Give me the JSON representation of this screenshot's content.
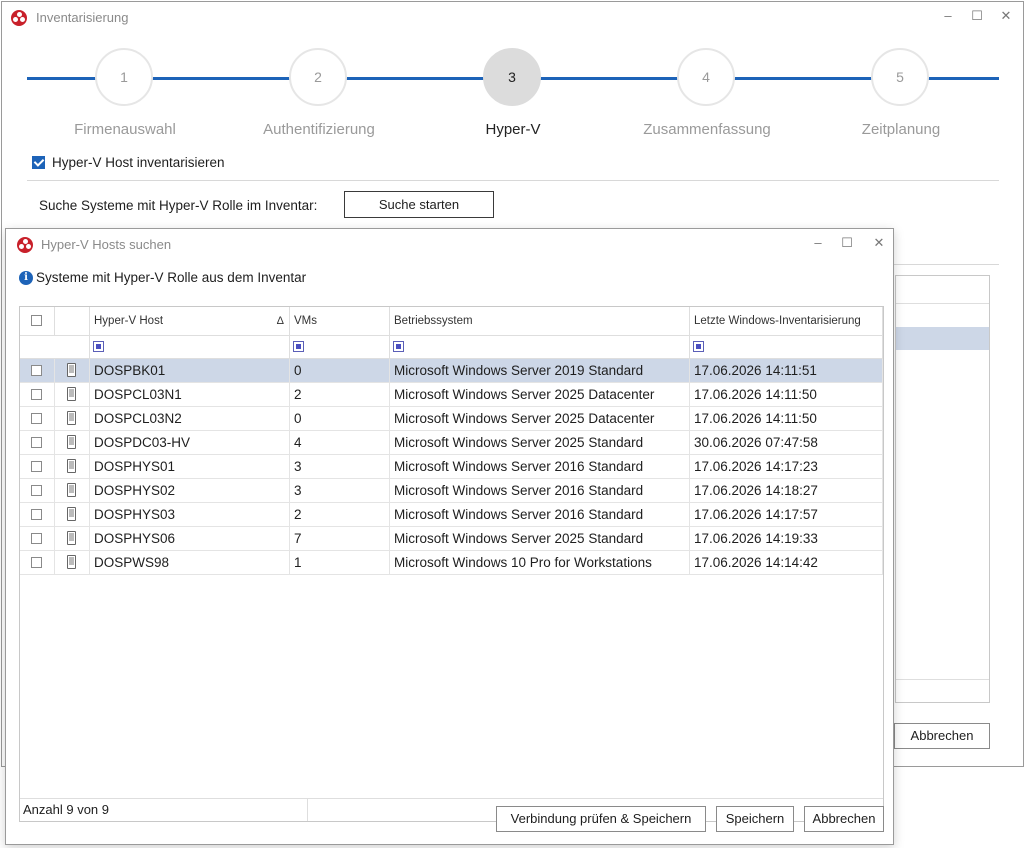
{
  "main_window": {
    "title": "Inventarisierung",
    "minimize": "–",
    "maximize": "☐",
    "close": "✕",
    "steps": [
      {
        "number": "1",
        "label": "Firmenauswahl"
      },
      {
        "number": "2",
        "label": "Authentifizierung"
      },
      {
        "number": "3",
        "label": "Hyper-V"
      },
      {
        "number": "4",
        "label": "Zusammenfassung"
      },
      {
        "number": "5",
        "label": "Zeitplanung"
      }
    ],
    "active_step": 3,
    "inventory_checkbox_label": "Hyper-V Host inventarisieren",
    "inventory_checkbox_checked": true,
    "search_label": "Suche Systeme mit Hyper-V Rolle im Inventar:",
    "search_button": "Suche starten",
    "cancel_button": "Abbrechen"
  },
  "dialog": {
    "title": "Hyper-V Hosts suchen",
    "minimize": "–",
    "maximize": "☐",
    "close": "✕",
    "info_text": "Systeme mit Hyper-V Rolle aus dem Inventar",
    "columns": {
      "host": "Hyper-V Host",
      "sort_indicator": "Δ",
      "vms": "VMs",
      "os": "Betriebssystem",
      "last_inventory": "Letzte Windows-Inventarisierung"
    },
    "rows": [
      {
        "host": "DOSPBK01",
        "vms": "0",
        "os": "Microsoft Windows Server 2019 Standard",
        "last": "17.06.2026 14:11:51"
      },
      {
        "host": "DOSPCL03N1",
        "vms": "2",
        "os": "Microsoft Windows Server 2025 Datacenter",
        "last": "17.06.2026 14:11:50"
      },
      {
        "host": "DOSPCL03N2",
        "vms": "0",
        "os": "Microsoft Windows Server 2025 Datacenter",
        "last": "17.06.2026 14:11:50"
      },
      {
        "host": "DOSPDC03-HV",
        "vms": "4",
        "os": "Microsoft Windows Server 2025 Standard",
        "last": "30.06.2026 07:47:58"
      },
      {
        "host": "DOSPHYS01",
        "vms": "3",
        "os": "Microsoft Windows Server 2016 Standard",
        "last": "17.06.2026 14:17:23"
      },
      {
        "host": "DOSPHYS02",
        "vms": "3",
        "os": "Microsoft Windows Server 2016 Standard",
        "last": "17.06.2026 14:18:27"
      },
      {
        "host": "DOSPHYS03",
        "vms": "2",
        "os": "Microsoft Windows Server 2016 Standard",
        "last": "17.06.2026 14:17:57"
      },
      {
        "host": "DOSPHYS06",
        "vms": "7",
        "os": "Microsoft Windows Server 2025 Standard",
        "last": "17.06.2026 14:19:33"
      },
      {
        "host": "DOSPWS98",
        "vms": "1",
        "os": "Microsoft Windows 10 Pro for Workstations",
        "last": "17.06.2026 14:14:42"
      }
    ],
    "selected_row": 0,
    "count_text": "Anzahl 9 von 9",
    "buttons": {
      "verify_save": "Verbindung prüfen & Speichern",
      "save": "Speichern",
      "cancel": "Abbrechen"
    }
  },
  "colors": {
    "accent": "#1d63b8",
    "selected_row": "#cdd7e7",
    "app_icon": "#c8202a"
  },
  "icons": [
    "app-icon",
    "minimize-icon",
    "maximize-icon",
    "close-icon",
    "checkbox-icon",
    "info-icon",
    "sort-icon",
    "filter-icon",
    "server-icon"
  ]
}
